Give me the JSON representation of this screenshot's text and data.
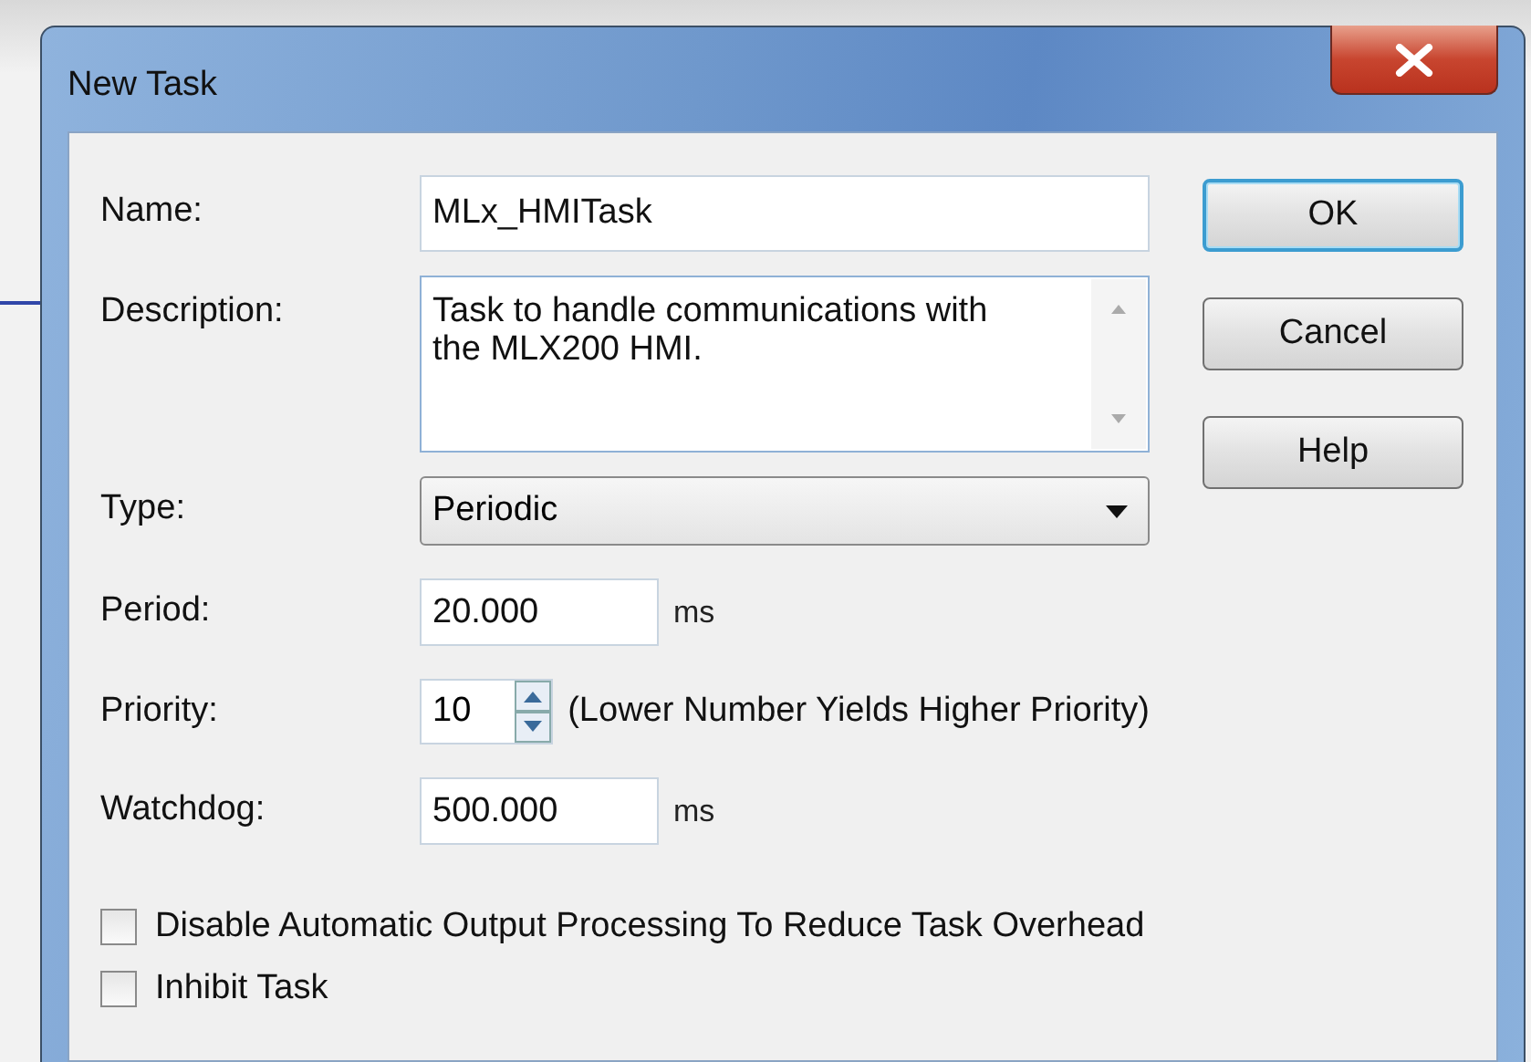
{
  "window": {
    "title": "New Task"
  },
  "fields": [
    {
      "kind": "text",
      "label": "Name:",
      "value": "MLx_HMITask"
    },
    {
      "kind": "textarea",
      "label": "Description:",
      "value": "Task to handle communications with the MLX200 HMI."
    },
    {
      "kind": "dropdown",
      "label": "Type:",
      "value": "Periodic"
    },
    {
      "kind": "number",
      "label": "Period:",
      "value": "20.000",
      "unit": "ms"
    },
    {
      "kind": "spinner",
      "label": "Priority:",
      "value": "10",
      "note": "(Lower Number Yields Higher Priority)"
    },
    {
      "kind": "number",
      "label": "Watchdog:",
      "value": "500.000",
      "unit": "ms"
    }
  ],
  "checkboxes": [
    {
      "label": "Disable Automatic Output Processing To Reduce Task Overhead",
      "checked": false
    },
    {
      "label": "Inhibit Task",
      "checked": false
    }
  ],
  "buttons": [
    {
      "label": "OK",
      "default": true
    },
    {
      "label": "Cancel",
      "default": false
    },
    {
      "label": "Help",
      "default": false
    }
  ]
}
